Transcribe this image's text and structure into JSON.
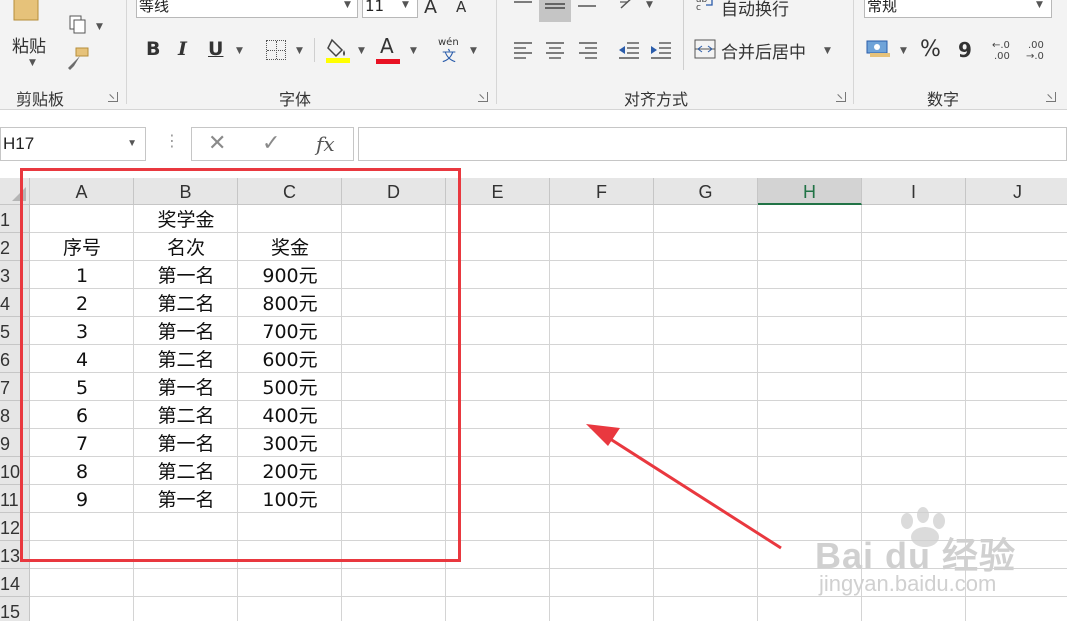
{
  "ribbon": {
    "clipboard": {
      "paste_label": "粘贴",
      "group_label": "剪贴板"
    },
    "font": {
      "font_name": "等线",
      "font_size": "11",
      "grow_label": "A",
      "shrink_label": "A",
      "bold_label": "B",
      "italic_label": "I",
      "underline_label": "U",
      "font_color_label": "A",
      "phonetic_top": "wén",
      "phonetic_bottom": "文",
      "group_label": "字体"
    },
    "alignment": {
      "wrap_text_label": "自动换行",
      "merge_center_label": "合并后居中",
      "group_label": "对齐方式"
    },
    "number": {
      "format_value": "常规",
      "percent_label": "%",
      "comma_label": "9",
      "inc_decimal_label": "←.0\n.00",
      "dec_decimal_label": ".00\n→.0",
      "group_label": "数字"
    }
  },
  "formula_bar": {
    "name_box": "H17",
    "cancel_label": "✕",
    "enter_label": "✓",
    "fx_label": "fx",
    "formula": ""
  },
  "grid": {
    "columns": [
      "A",
      "B",
      "C",
      "D",
      "E",
      "F",
      "G",
      "H",
      "I",
      "J"
    ],
    "active_column": "H",
    "rows": [
      "1",
      "2",
      "3",
      "4",
      "5",
      "6",
      "7",
      "8",
      "9",
      "10",
      "11",
      "12",
      "13",
      "14",
      "15"
    ],
    "title": "奖学金",
    "headers": [
      "序号",
      "名次",
      "奖金"
    ],
    "records": [
      [
        "1",
        "第一名",
        "900元"
      ],
      [
        "2",
        "第二名",
        "800元"
      ],
      [
        "3",
        "第一名",
        "700元"
      ],
      [
        "4",
        "第二名",
        "600元"
      ],
      [
        "5",
        "第一名",
        "500元"
      ],
      [
        "6",
        "第二名",
        "400元"
      ],
      [
        "7",
        "第一名",
        "300元"
      ],
      [
        "8",
        "第二名",
        "200元"
      ],
      [
        "9",
        "第一名",
        "100元"
      ]
    ]
  },
  "annotation": {
    "color": "#e9383f"
  },
  "watermark": {
    "brand": "Bai du 经验",
    "url": "jingyan.baidu.com"
  },
  "colors": {
    "accent": "#217346",
    "font_color_bar": "#e81123",
    "highlight_bar": "#ffff00"
  }
}
